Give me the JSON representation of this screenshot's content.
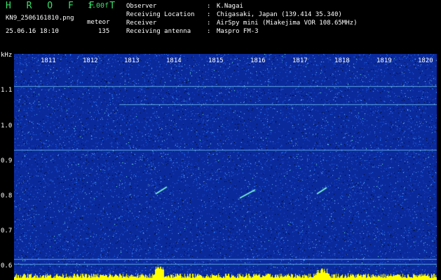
{
  "header": {
    "brand": "H R O F F T",
    "version": "1.00f",
    "filename": "KN9_2506161810.png",
    "datetime": "25.06.16 18:10",
    "mode": "meteor",
    "count": "135"
  },
  "station": [
    {
      "label": "Observer",
      "value": "K.Nagai"
    },
    {
      "label": "Receiving Location",
      "value": "Chigasaki, Japan (139.414 35.340)"
    },
    {
      "label": "Receiver",
      "value": "AirSpy mini (Miakejima VOR 108.65MHz)"
    },
    {
      "label": "Receiving antenna",
      "value": "Maspro FM-3"
    }
  ],
  "separator": ":",
  "axis": {
    "y_unit": "kHz",
    "y_ticks": [
      "1.1",
      "1.0",
      "0.9",
      "0.8",
      "0.7",
      "0.6"
    ],
    "x_ticks": [
      "1811",
      "1812",
      "1813",
      "1814",
      "1815",
      "1816",
      "1817",
      "1818",
      "1819",
      "1820"
    ]
  },
  "colors": {
    "background": "#0a2a9c",
    "noise": "#2f7cff",
    "signal": "#7fffd4",
    "bars": "#ffff00",
    "brand": "#39e06a"
  }
}
